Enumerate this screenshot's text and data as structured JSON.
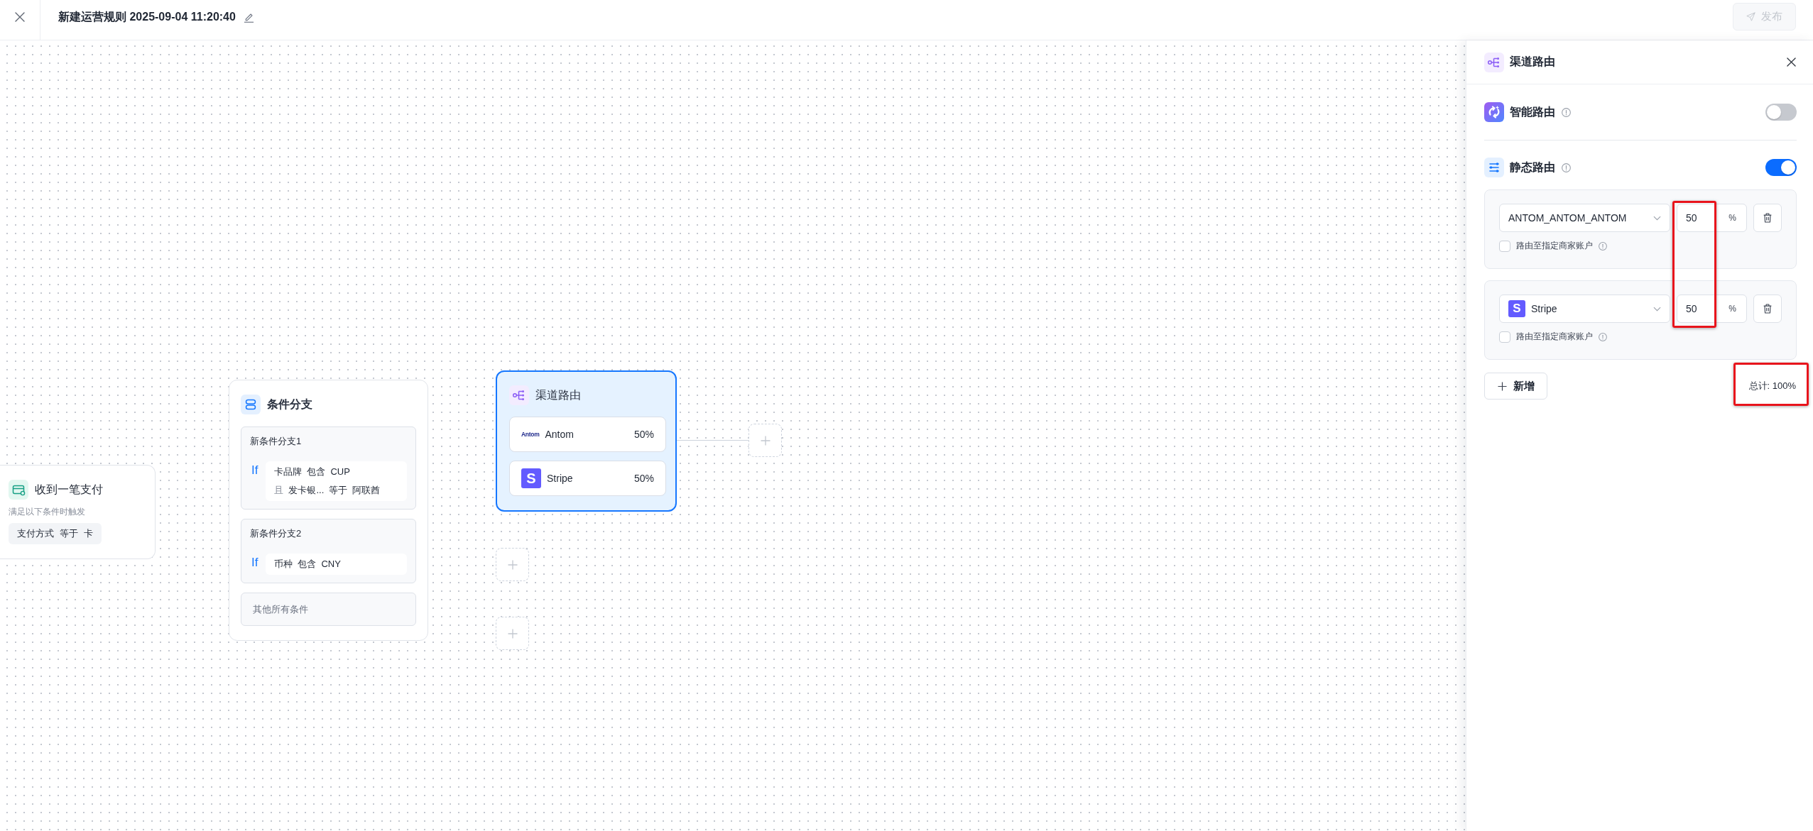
{
  "header": {
    "title": "新建运营规则 2025-09-04 11:20:40",
    "publish": {
      "label": "发布",
      "disabled": true
    }
  },
  "canvas": {
    "nodes": [
      {
        "kind": "trigger",
        "selected": false,
        "title": "收到一笔支付",
        "subtitle": "满足以下条件时触发",
        "conditions": [
          {
            "field": "支付方式",
            "operator": "等于",
            "value": "卡"
          }
        ]
      },
      {
        "kind": "condition",
        "selected": false,
        "title": "条件分支",
        "branches": [
          {
            "kind": "rule",
            "label": "新条件分支1",
            "keyword": "If",
            "conditions": [
              {
                "field": "卡品牌",
                "operator": "包含",
                "value": "CUP"
              },
              {
                "conjunction": "且",
                "field": "发卡银...",
                "operator": "等于",
                "value": "阿联酋"
              }
            ]
          },
          {
            "kind": "rule",
            "label": "新条件分支2",
            "keyword": "If",
            "conditions": [
              {
                "field": "币种",
                "operator": "包含",
                "value": "CNY"
              }
            ]
          },
          {
            "kind": "fallback",
            "label": "其他所有条件"
          }
        ]
      },
      {
        "kind": "routing",
        "selected": true,
        "title": "渠道路由",
        "channels": [
          {
            "logo": {
              "kind": "wordmark",
              "text": "Antom"
            },
            "name": "Antom",
            "share": "50%"
          },
          {
            "logo": {
              "kind": "letter",
              "text": "S"
            },
            "name": "Stripe",
            "share": "50%"
          }
        ],
        "next": {
          "kind": "add"
        }
      },
      {
        "kind": "add"
      },
      {
        "kind": "add"
      }
    ]
  },
  "panel": {
    "title": "渠道路由",
    "smart_routing": {
      "title": "智能路由",
      "on": false
    },
    "static_routing": {
      "title": "静态路由",
      "on": true,
      "percent_highlight": true,
      "routes": [
        {
          "channel": "ANTOM_ANTOM_ANTOM",
          "percent": "50",
          "unit": "%",
          "merchant_option": {
            "label": "路由至指定商家账户",
            "checked": false
          }
        },
        {
          "logo": {
            "kind": "letter",
            "text": "S"
          },
          "channel": "Stripe",
          "percent": "50",
          "unit": "%",
          "merchant_option": {
            "label": "路由至指定商家账户",
            "checked": false
          }
        }
      ]
    },
    "add_label": "新增",
    "total": {
      "text": "总计: 100%",
      "highlighted": true
    }
  }
}
